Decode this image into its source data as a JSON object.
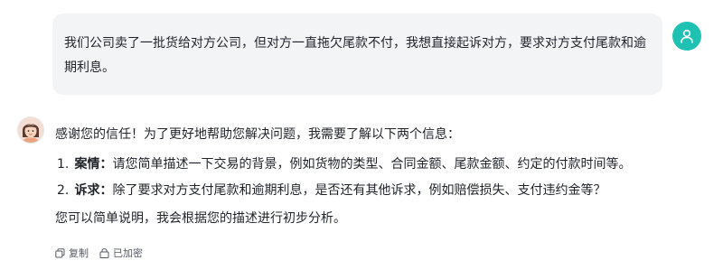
{
  "user_message": {
    "text": "我们公司卖了一批货给对方公司，但对方一直拖欠尾款不付，我想直接起诉对方，要求对方支付尾款和逾期利息。",
    "avatar_color": "#1fc2b2",
    "avatar_icon": "user-icon"
  },
  "assistant_message": {
    "intro": "感谢您的信任！为了更好地帮助您解决问题，我需要了解以下两个信息：",
    "items": [
      {
        "number": "1.",
        "term": "案情",
        "separator": "：",
        "text": "请您简单描述一下交易的背景，例如货物的类型、合同金额、尾款金额、约定的付款时间等。"
      },
      {
        "number": "2.",
        "term": "诉求",
        "separator": "：",
        "text": "除了要求对方支付尾款和逾期利息，是否还有其他诉求，例如赔偿损失、支付违约金等？"
      }
    ],
    "outro": "您可以简单说明，我会根据您的描述进行初步分析。"
  },
  "actions": {
    "copy_label": "复制",
    "copy_icon": "copy-icon",
    "encrypted_label": "已加密",
    "encrypted_icon": "lock-icon"
  }
}
